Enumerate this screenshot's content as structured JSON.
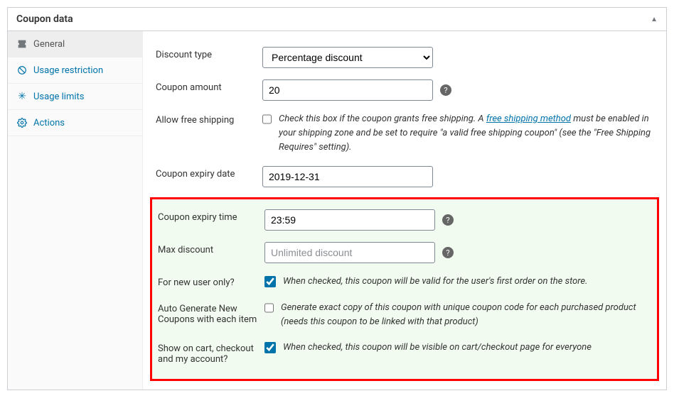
{
  "panel_title": "Coupon data",
  "tabs": [
    {
      "id": "general",
      "label": "General",
      "icon": "ticket"
    },
    {
      "id": "usage_restriction",
      "label": "Usage restriction",
      "icon": "block"
    },
    {
      "id": "usage_limits",
      "label": "Usage limits",
      "icon": "asterisk"
    },
    {
      "id": "actions",
      "label": "Actions",
      "icon": "gear"
    }
  ],
  "fields": {
    "discount_type": {
      "label": "Discount type",
      "value": "Percentage discount"
    },
    "coupon_amount": {
      "label": "Coupon amount",
      "value": "20"
    },
    "allow_free_shipping": {
      "label": "Allow free shipping",
      "checked": false,
      "desc_pre": "Check this box if the coupon grants free shipping. A ",
      "desc_link": "free shipping method",
      "desc_post": " must be enabled in your shipping zone and be set to require \"a valid free shipping coupon\" (see the \"Free Shipping Requires\" setting)."
    },
    "coupon_expiry_date": {
      "label": "Coupon expiry date",
      "value": "2019-12-31"
    },
    "coupon_expiry_time": {
      "label": "Coupon expiry time",
      "value": "23:59"
    },
    "max_discount": {
      "label": "Max discount",
      "value": "",
      "placeholder": "Unlimited discount"
    },
    "new_user_only": {
      "label": "For new user only?",
      "checked": true,
      "desc": "When checked, this coupon will be valid for the user's first order on the store."
    },
    "auto_generate": {
      "label": "Auto Generate New Coupons with each item",
      "checked": false,
      "desc": "Generate exact copy of this coupon with unique coupon code for each purchased product (needs this coupon to be linked with that product)"
    },
    "show_on_cart": {
      "label": "Show on cart, checkout and my account?",
      "checked": true,
      "desc": "When checked, this coupon will be visible on cart/checkout page for everyone"
    }
  }
}
